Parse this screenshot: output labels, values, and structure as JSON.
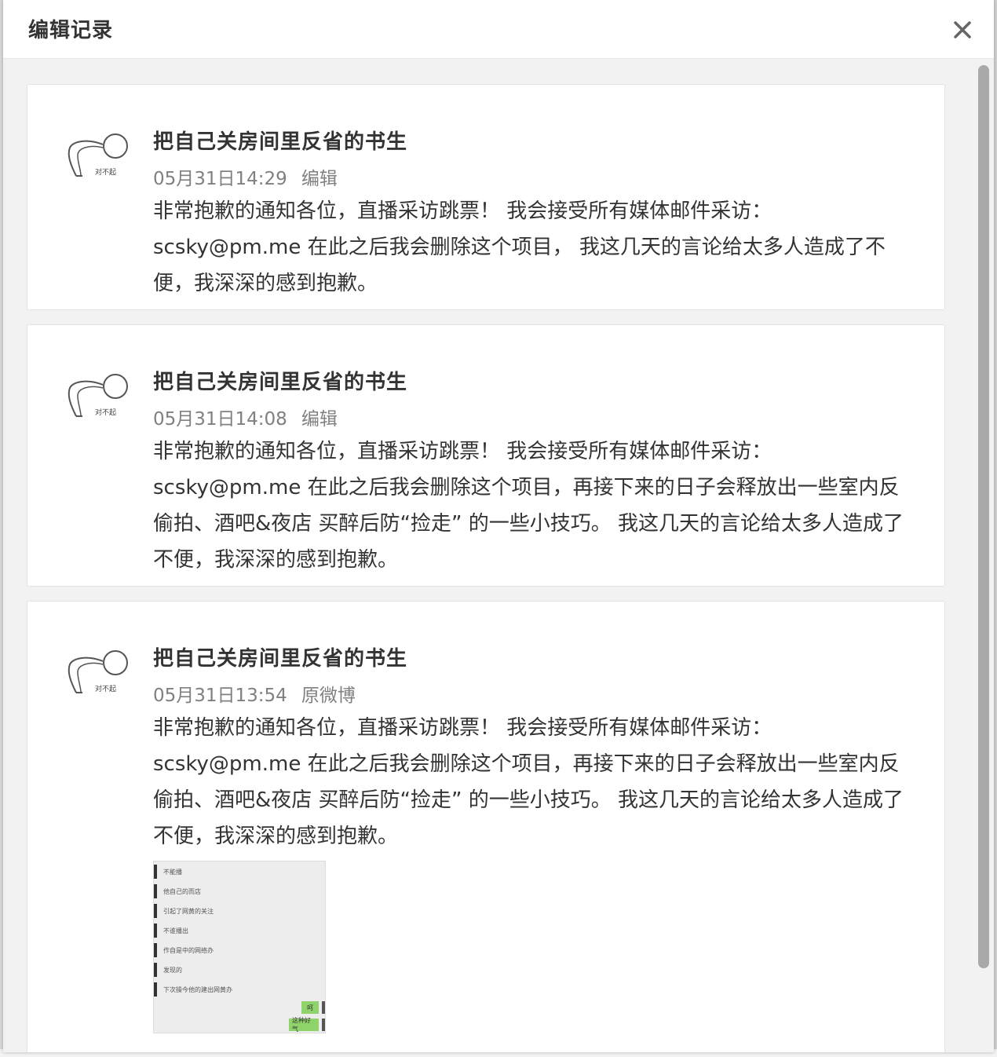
{
  "dialog": {
    "title": "编辑记录"
  },
  "records": [
    {
      "author": "把自己关房间里反省的书生",
      "avatar_text": "对不起",
      "time": "05月31日14:29",
      "kind": "编辑",
      "content": "非常抱歉的通知各位，直播采访跳票！ 我会接受所有媒体邮件采访：scsky@pm.me 在此之后我会删除这个项目， 我这几天的言论给太多人造成了不便，我深深的感到抱歉。"
    },
    {
      "author": "把自己关房间里反省的书生",
      "avatar_text": "对不起",
      "time": "05月31日14:08",
      "kind": "编辑",
      "content": "非常抱歉的通知各位，直播采访跳票！ 我会接受所有媒体邮件采访：scsky@pm.me 在此之后我会删除这个项目，再接下来的日子会释放出一些室内反偷拍、酒吧&夜店 买醉后防“捡走” 的一些小技巧。 我这几天的言论给太多人造成了不便，我深深的感到抱歉。"
    },
    {
      "author": "把自己关房间里反省的书生",
      "avatar_text": "对不起",
      "time": "05月31日13:54",
      "kind": "原微博",
      "content": "非常抱歉的通知各位，直播采访跳票！ 我会接受所有媒体邮件采访：scsky@pm.me 在此之后我会删除这个项目，再接下来的日子会释放出一些室内反偷拍、酒吧&夜店 买醉后防“捡走” 的一些小技巧。 我这几天的言论给太多人造成了不便，我深深的感到抱歉。",
      "image": {
        "messages": [
          "不能播",
          "他自己的而店",
          "引起了网黄的关注",
          "不谁播出",
          "作自是中的网络办",
          "发现的",
          "下次操今他的建出网黄办"
        ],
        "replies": [
          "呵",
          "这种好气"
        ]
      }
    }
  ]
}
